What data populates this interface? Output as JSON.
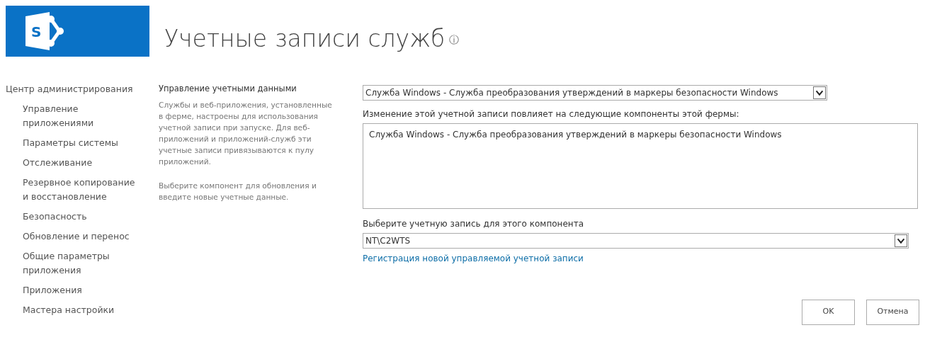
{
  "header": {
    "logo_letter": "S",
    "title": "Учетные записи служб",
    "info_icon": "ⓘ"
  },
  "sidebar": {
    "items": [
      {
        "label": "Центр администрирования",
        "children": [
          {
            "label": "Управление приложениями"
          },
          {
            "label": "Параметры системы"
          },
          {
            "label": "Отслеживание"
          },
          {
            "label": "Резервное копирование и восстановление"
          },
          {
            "label": "Безопасность"
          },
          {
            "label": "Обновление и перенос"
          },
          {
            "label": "Общие параметры приложения"
          },
          {
            "label": "Приложения"
          },
          {
            "label": "Мастера настройки"
          }
        ]
      }
    ]
  },
  "section": {
    "title": "Управление учетными данными",
    "paragraphs": [
      "Службы и веб-приложения, установленные в ферме, настроены для использования учетной записи при запуске. Для веб-приложений и приложений-служб эти учетные записи привязываются к пулу приложений.",
      "Выберите компонент для обновления и введите новые учетные данные."
    ]
  },
  "form": {
    "component_select": {
      "value": "Служба Windows - Служба преобразования утверждений в маркеры безопасности Windows"
    },
    "affected_label": "Изменение этой учетной записи повлияет на следующие компоненты этой фермы:",
    "affected_components": [
      "Служба Windows - Служба преобразования утверждений в маркеры безопасности Windows"
    ],
    "account_label": "Выберите учетную запись для этого компонента",
    "account_select": {
      "value": "NT\\C2WTS"
    },
    "register_link": "Регистрация новой управляемой учетной записи"
  },
  "buttons": [
    "OK",
    "Отмена"
  ]
}
